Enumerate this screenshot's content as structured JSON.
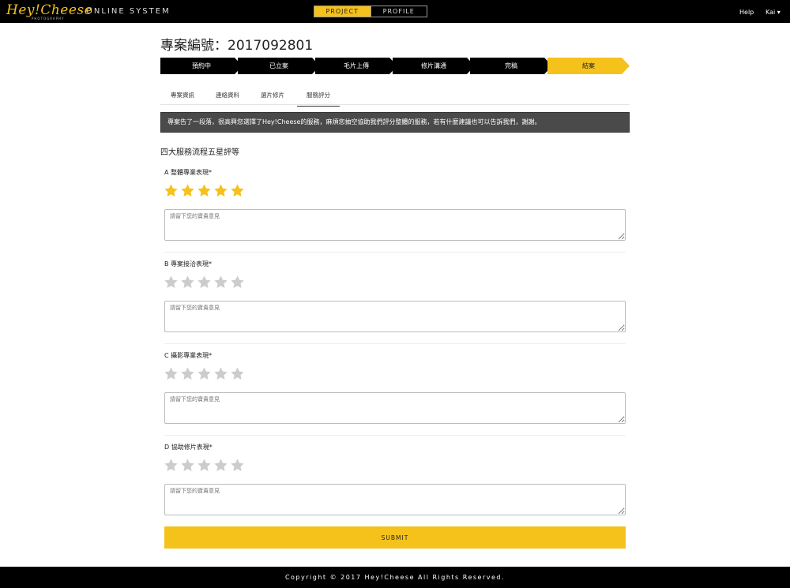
{
  "header": {
    "logo": "Hey!Cheese",
    "logo_sub": "PHOTOGRAPHY",
    "system": "ONLINE SYSTEM",
    "tab_project": "PROJECT",
    "tab_profile": "PROFILE",
    "help": "Help",
    "user": "Kai ▾"
  },
  "page": {
    "title": "專案編號：2017092801"
  },
  "steps": [
    {
      "label": "預約中"
    },
    {
      "label": "已立案"
    },
    {
      "label": "毛片上傳"
    },
    {
      "label": "修片溝通"
    },
    {
      "label": "完稿"
    },
    {
      "label": "結案"
    }
  ],
  "tabs": [
    {
      "label": "專案資訊"
    },
    {
      "label": "連絡資料"
    },
    {
      "label": "選片修片"
    },
    {
      "label": "服務評分"
    }
  ],
  "notice": "專案告了一段落，很高興您選擇了Hey!Cheese的服務，麻煩您抽空協助我們評分整體的服務，若有什麼建議也可以告訴我們，謝謝。",
  "section_title": "四大服務流程五星評等",
  "questions": [
    {
      "label": "A 整體專業表現*",
      "rating": 5,
      "placeholder": "請留下您的寶貴意見"
    },
    {
      "label": "B 專案接洽表現*",
      "rating": 0,
      "placeholder": "請留下您的寶貴意見"
    },
    {
      "label": "C 攝影專業表現*",
      "rating": 0,
      "placeholder": "請留下您的寶貴意見"
    },
    {
      "label": "D 協助修片表現*",
      "rating": 0,
      "placeholder": "請留下您的寶貴意見"
    }
  ],
  "submit_label": "SUBMIT",
  "footer": "Copyright © 2017 Hey!Cheese All Rights Reserved.",
  "colors": {
    "accent": "#f5c21b",
    "star_on": "#f5c21b",
    "star_off": "#cccccc"
  }
}
